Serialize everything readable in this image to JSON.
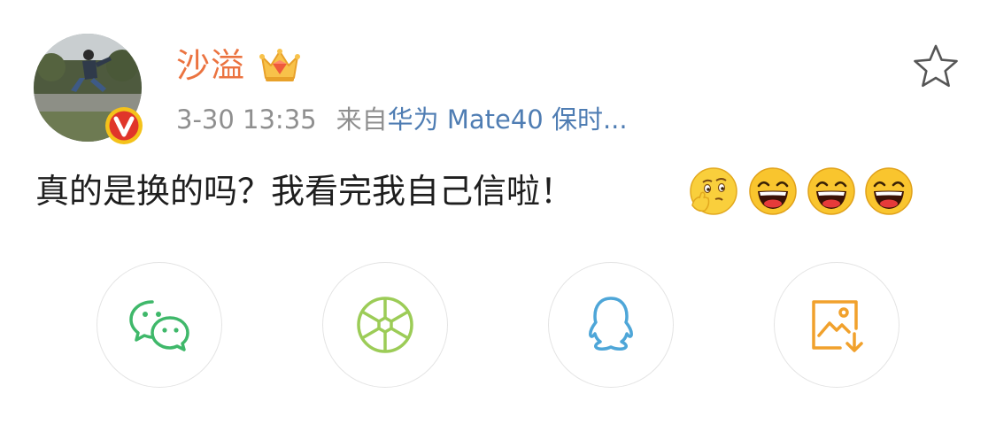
{
  "post": {
    "username": "沙溢",
    "timestamp": "3-30 13:35",
    "source_prefix": "来自",
    "source_device": "华为 Mate40 保时...",
    "text": "真的是换的吗？我看完我自己信啦！",
    "emojis": [
      "thinking-emoji",
      "laughing-emoji",
      "laughing-emoji",
      "laughing-emoji"
    ]
  },
  "icons": {
    "badge": "verified-v-icon",
    "crown": "vip-crown-icon",
    "favorite": "star-outline-icon"
  },
  "share": [
    {
      "name": "wechat",
      "icon": "wechat-icon",
      "color": "#3fb86a"
    },
    {
      "name": "wechat-moments",
      "icon": "moments-aperture-icon",
      "color": "#9ccc57"
    },
    {
      "name": "qq",
      "icon": "qq-penguin-icon",
      "color": "#4ea6d8"
    },
    {
      "name": "save-image",
      "icon": "save-image-icon",
      "color": "#f1a12c"
    }
  ],
  "colors": {
    "username": "#eb7340",
    "meta": "#8f8f8f",
    "link": "#4f7db3",
    "text": "#1e1e1e"
  }
}
